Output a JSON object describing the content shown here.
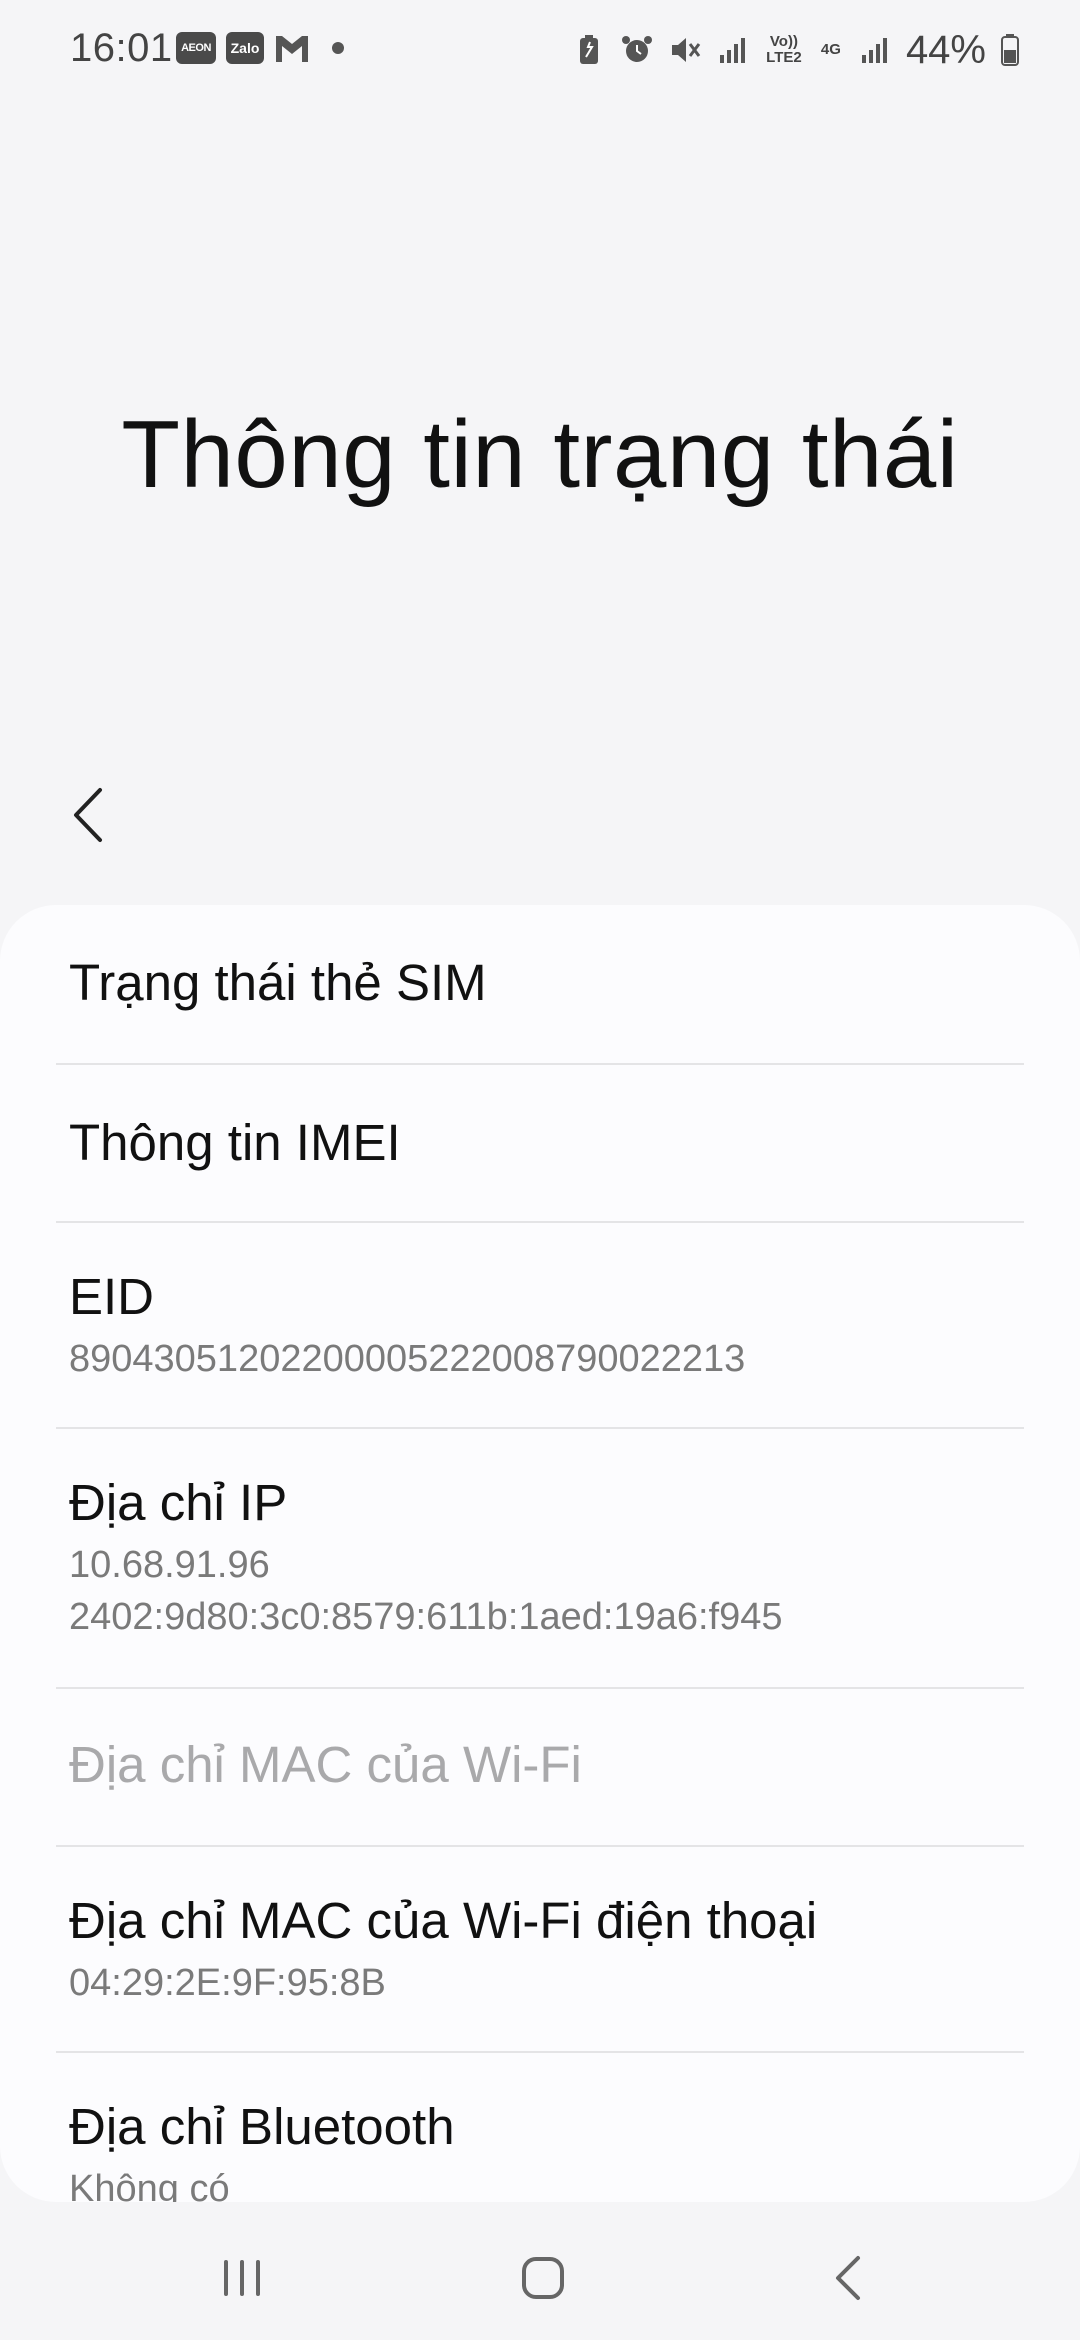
{
  "status_bar": {
    "time": "16:01",
    "apps": [
      "AEON",
      "Zalo"
    ],
    "network_volte": "Vo)) LTE2",
    "network_4g": "4G",
    "battery": "44%",
    "icons": [
      "gmail-icon",
      "dot-icon",
      "battery-saver-icon",
      "alarm-icon",
      "mute-icon",
      "signal-icon",
      "battery-icon"
    ]
  },
  "header": {
    "title": "Thông tin trạng thái",
    "back_icon": "back-chevron-icon"
  },
  "items": [
    {
      "label": "Trạng thái thẻ SIM"
    },
    {
      "label": "Thông tin IMEI"
    },
    {
      "label": "EID",
      "value": "89043051202200005222008790022213"
    },
    {
      "label": "Địa chỉ IP",
      "value_lines": [
        "10.68.91.96",
        "2402:9d80:3c0:8579:611b:1aed:19a6:f945"
      ]
    },
    {
      "label": "Địa chỉ MAC của Wi-Fi",
      "disabled": true
    },
    {
      "label": "Địa chỉ MAC của Wi-Fi điện thoại",
      "value": "04:29:2E:9F:95:8B"
    },
    {
      "label": "Địa chỉ Bluetooth",
      "value": "Không có"
    }
  ],
  "nav_bar": {
    "icons": [
      "recent-apps-icon",
      "home-icon",
      "back-icon"
    ]
  },
  "colors": {
    "background": "#f5f5f7",
    "card": "#fcfcfe",
    "primary_text": "#111111",
    "secondary_text": "#7a7a7a",
    "disabled_text": "#a9a9ab"
  }
}
